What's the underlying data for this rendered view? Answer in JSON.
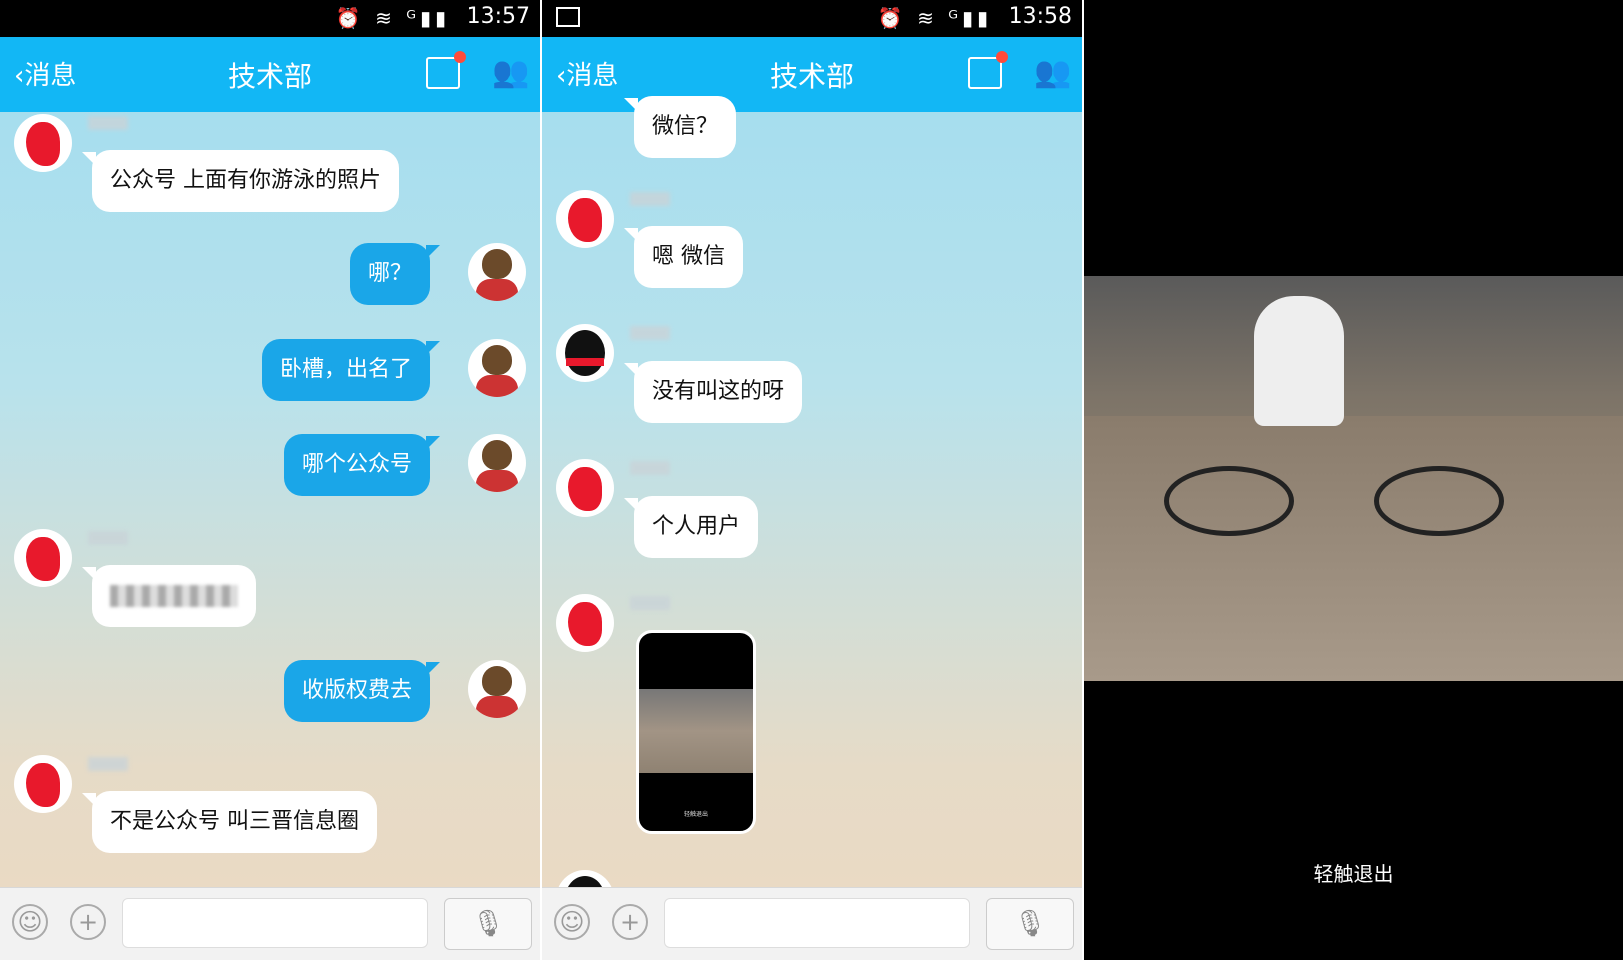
{
  "screens": [
    {
      "status": {
        "time": "13:57",
        "icons": "⏰ ≋ ᴳ▮▮"
      },
      "header": {
        "back_label": "消息",
        "title": "技术部"
      },
      "messages": [
        {
          "dir": "in",
          "text": "公众号 上面有你游泳的照片"
        },
        {
          "dir": "out",
          "text": "哪？"
        },
        {
          "dir": "out",
          "text": "卧槽，出名了"
        },
        {
          "dir": "out",
          "text": "哪个公众号"
        },
        {
          "dir": "in",
          "text": ""
        },
        {
          "dir": "out",
          "text": "收版权费去"
        },
        {
          "dir": "in",
          "text": "不是公众号 叫三晋信息圈"
        }
      ]
    },
    {
      "status": {
        "time": "13:58",
        "icons": "⏰ ≋ ᴳ▮▮"
      },
      "header": {
        "back_label": "消息",
        "title": "技术部"
      },
      "messages": [
        {
          "dir": "in",
          "text": "微信？"
        },
        {
          "dir": "in",
          "text": "嗯 微信"
        },
        {
          "dir": "in",
          "text": "没有叫这的呀"
        },
        {
          "dir": "in",
          "text": "个人用户"
        },
        {
          "dir": "in",
          "type": "video",
          "caption": "轻触退出"
        }
      ]
    }
  ],
  "viewer": {
    "exit_label": "轻触退出"
  },
  "colors": {
    "header": "#12b7f5",
    "bubble_out": "#1aa6e8",
    "bubble_in": "#ffffff",
    "badge": "#ff4b3a"
  },
  "icons": {
    "back": "chevron-left-icon",
    "notes": "notes-icon",
    "group": "group-icon",
    "emoji": "emoji-icon",
    "plus": "plus-icon",
    "mic": "microphone-icon"
  }
}
